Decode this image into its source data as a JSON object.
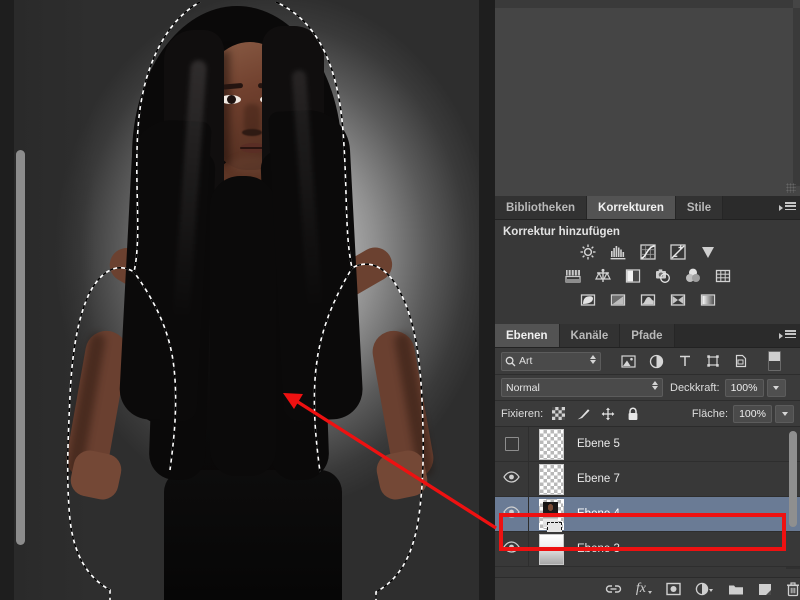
{
  "app": {
    "name": "Adobe Photoshop",
    "document_selection_active": true
  },
  "canvas": {
    "name": "image-canvas",
    "description": "Portrait of a woman with long dark hair, hands on hips, on a gray gradient studio background, with an active marching-ants selection around her silhouette",
    "selection_outline": "marching-ants",
    "scrollbar_name": "canvas-vertical-scrollbar"
  },
  "annotation": {
    "arrow_color": "#ee1111",
    "highlight_color": "#ee1111",
    "arrow_from": "Ebene 4 layer row",
    "arrow_to": "image canvas",
    "highlighted_layer": "Ebene 4"
  },
  "panels": {
    "top_dock": {
      "name": "empty-panel-area"
    },
    "corrections": {
      "tabs": [
        {
          "label": "Bibliotheken",
          "active": false
        },
        {
          "label": "Korrekturen",
          "active": true
        },
        {
          "label": "Stile",
          "active": false
        }
      ],
      "title": "Korrektur hinzufügen",
      "menu_icon": "panel-menu-icon",
      "adjustment_rows": [
        [
          {
            "name": "brightness-contrast-icon",
            "label": "Helligkeit/Kontrast"
          },
          {
            "name": "levels-icon",
            "label": "Tonwertkorrektur"
          },
          {
            "name": "curves-icon",
            "label": "Gradationskurven"
          },
          {
            "name": "exposure-icon",
            "label": "Belichtung"
          },
          {
            "name": "vibrance-icon",
            "label": "Dynamik"
          }
        ],
        [
          {
            "name": "hue-saturation-icon",
            "label": "Farbton/Sättigung"
          },
          {
            "name": "color-balance-icon",
            "label": "Farbbalance"
          },
          {
            "name": "black-white-icon",
            "label": "Schwarzweiß"
          },
          {
            "name": "photo-filter-icon",
            "label": "Fotofilter"
          },
          {
            "name": "channel-mixer-icon",
            "label": "Kanalmixer"
          },
          {
            "name": "color-lookup-icon",
            "label": "Farbsuche"
          }
        ],
        [
          {
            "name": "invert-icon",
            "label": "Umkehren"
          },
          {
            "name": "posterize-icon",
            "label": "Tontrennung"
          },
          {
            "name": "threshold-icon",
            "label": "Schwellenwert"
          },
          {
            "name": "selective-color-icon",
            "label": "Selektive Farbkorrektur"
          },
          {
            "name": "gradient-map-icon",
            "label": "Verlaufsumsetzung"
          }
        ]
      ]
    },
    "layers": {
      "tabs": [
        {
          "label": "Ebenen",
          "active": true
        },
        {
          "label": "Kanäle",
          "active": false
        },
        {
          "label": "Pfade",
          "active": false
        }
      ],
      "menu_icon": "panel-menu-icon",
      "filter": {
        "select_value": "Art",
        "search_icon": "search-icon",
        "type_filters": [
          {
            "name": "filter-pixel-icon"
          },
          {
            "name": "filter-adjustment-icon"
          },
          {
            "name": "filter-type-icon"
          },
          {
            "name": "filter-shape-icon"
          },
          {
            "name": "filter-smart-object-icon"
          }
        ],
        "toggle_name": "filter-enable-toggle"
      },
      "blend": {
        "mode": "Normal",
        "opacity_label": "Deckkraft:",
        "opacity_value": "100%"
      },
      "lock": {
        "label": "Fixieren:",
        "icons": [
          {
            "name": "lock-transparency-icon"
          },
          {
            "name": "lock-image-icon"
          },
          {
            "name": "lock-position-icon"
          },
          {
            "name": "lock-all-icon"
          }
        ],
        "fill_label": "Fläche:",
        "fill_value": "100%"
      },
      "rows": [
        {
          "name": "Ebene 5",
          "visible": false,
          "selected": false,
          "thumb": "transparent"
        },
        {
          "name": "Ebene 7",
          "visible": true,
          "selected": false,
          "thumb": "transparent"
        },
        {
          "name": "Ebene 4",
          "visible": true,
          "selected": true,
          "thumb": "portrait"
        },
        {
          "name": "Ebene 3",
          "visible": true,
          "selected": false,
          "thumb": "gradient"
        }
      ],
      "toolbar": [
        {
          "name": "link-layers-icon"
        },
        {
          "name": "layer-style-fx-icon"
        },
        {
          "name": "add-layer-mask-icon"
        },
        {
          "name": "new-adjustment-layer-icon"
        },
        {
          "name": "new-group-icon"
        },
        {
          "name": "new-layer-icon"
        },
        {
          "name": "delete-layer-icon"
        }
      ],
      "scrollbar_name": "layer-list-scrollbar"
    }
  }
}
